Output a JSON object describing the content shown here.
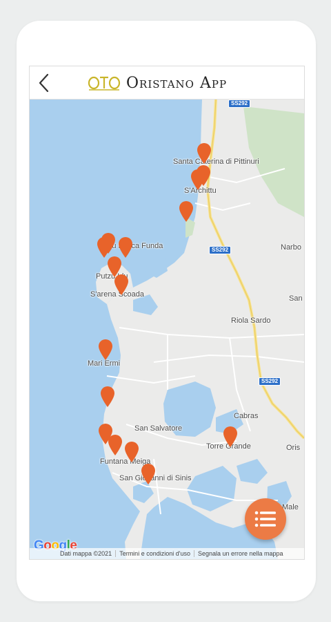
{
  "app": {
    "title": "Oristano App",
    "logo_text": "OTO",
    "back_icon": "chevron-left-icon",
    "brand_color": "#c9b52a"
  },
  "map": {
    "colors": {
      "water": "#a9cfee",
      "land": "#ebebea",
      "road_major": "#f8e28a",
      "park": "#cfe3c7",
      "pin": "#e8632a"
    },
    "place_labels": [
      "Santa Caterina di Pittinuri",
      "S'Archittu",
      "Narbo",
      "Su Bucca Funda",
      "Putzu Idu",
      "S'arena Scoada",
      "San",
      "Riola Sardo",
      "Mari Ermi",
      "Cabras",
      "San Salvatore",
      "Torre Grande",
      "Oris",
      "Funtana Meiga",
      "San Giovanni di Sinis",
      "Male"
    ],
    "road_shields": [
      "SS292",
      "SS292",
      "SS292"
    ],
    "marker_count": 17,
    "marker_icon": "map-pin-icon"
  },
  "fab": {
    "icon": "list-menu-icon"
  },
  "attribution": {
    "logo": "Google",
    "data": "Dati mappa ©2021",
    "terms": "Termini e condizioni d'uso",
    "report": "Segnala un errore nella mappa"
  }
}
